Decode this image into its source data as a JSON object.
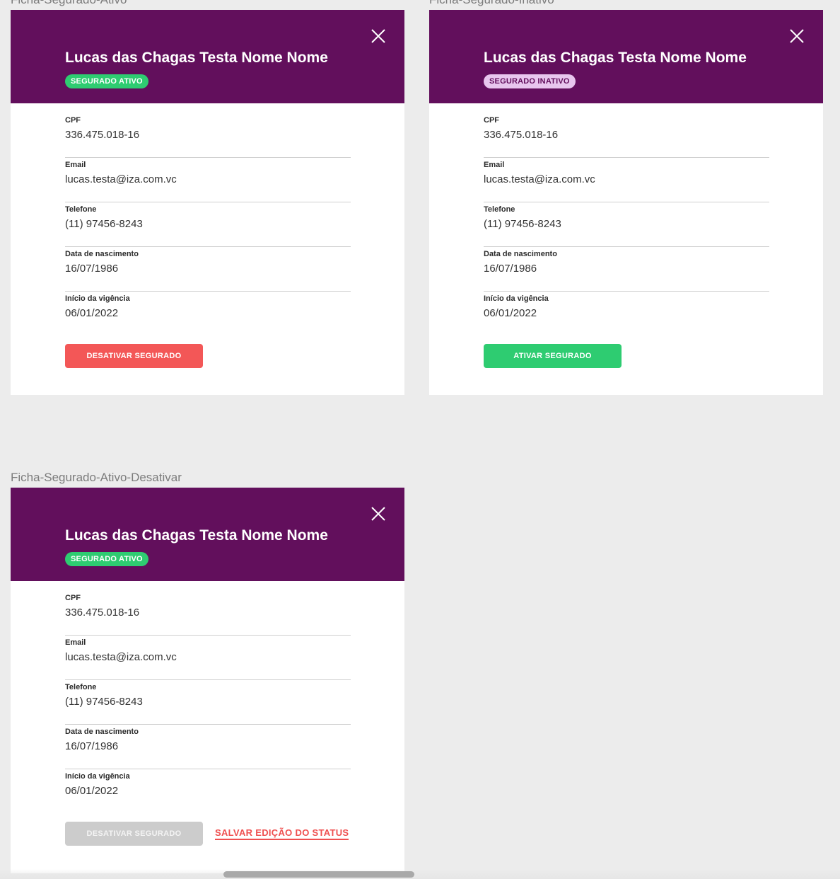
{
  "frames": {
    "active": {
      "label": "Ficha-Segurado-Ativo"
    },
    "inactive": {
      "label": "Ficha-Segurado-Inativo"
    },
    "deactivate": {
      "label": "Ficha-Segurado-Ativo-Desativar"
    }
  },
  "person": {
    "name": "Lucas das Chagas Testa Nome Nome"
  },
  "badges": {
    "active": "SEGURADO ATIVO",
    "inactive": "SEGURADO INATIVO"
  },
  "fields": {
    "cpf": {
      "label": "CPF",
      "value": "336.475.018-16"
    },
    "email": {
      "label": "Email",
      "value": "lucas.testa@iza.com.vc"
    },
    "phone": {
      "label": "Telefone",
      "value": "(11) 97456-8243"
    },
    "birth": {
      "label": "Data de nascimento",
      "value": "16/07/1986"
    },
    "start": {
      "label": "Início da vigência",
      "value": "06/01/2022"
    }
  },
  "actions": {
    "deactivate": "DESATIVAR SEGURADO",
    "activate": "ATIVAR SEGURADO",
    "save_status": "SALVAR EDIÇÃO DO STATUS"
  },
  "icons": {
    "close": "close-icon"
  },
  "colors": {
    "header": "#620f5c",
    "active_green": "#2ecc71",
    "inactive_badge": "#e8c6ee",
    "danger": "#f35757",
    "disabled": "#cccccc",
    "background": "#ececec"
  }
}
